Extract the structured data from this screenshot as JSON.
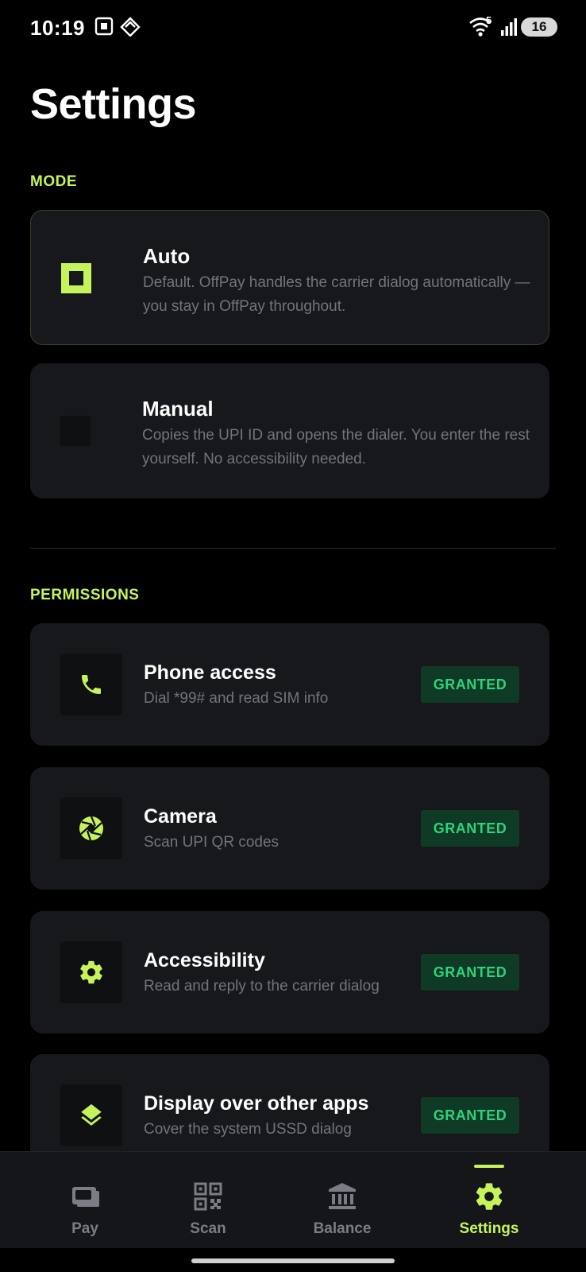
{
  "status_bar": {
    "time": "10:19",
    "battery": "16",
    "network_label": "5"
  },
  "page": {
    "title": "Settings"
  },
  "mode": {
    "section_label": "MODE",
    "options": [
      {
        "title": "Auto",
        "description": "Default. OffPay handles the carrier dialog automatically — you stay in OffPay throughout.",
        "selected": true
      },
      {
        "title": "Manual",
        "description": "Copies the UPI ID and opens the dialer. You enter the rest yourself. No accessibility needed.",
        "selected": false
      }
    ]
  },
  "permissions": {
    "section_label": "PERMISSIONS",
    "items": [
      {
        "title": "Phone access",
        "description": "Dial *99# and read SIM info",
        "status": "GRANTED",
        "icon": "phone-icon"
      },
      {
        "title": "Camera",
        "description": "Scan UPI QR codes",
        "status": "GRANTED",
        "icon": "camera-aperture-icon"
      },
      {
        "title": "Accessibility",
        "description": "Read and reply to the carrier dialog",
        "status": "GRANTED",
        "icon": "gear-icon"
      },
      {
        "title": "Display over other apps",
        "description": "Cover the system USSD dialog",
        "status": "GRANTED",
        "icon": "layers-icon"
      }
    ]
  },
  "bottom_nav": {
    "items": [
      {
        "label": "Pay",
        "icon": "wallet-icon",
        "active": false
      },
      {
        "label": "Scan",
        "icon": "qr-code-icon",
        "active": false
      },
      {
        "label": "Balance",
        "icon": "bank-icon",
        "active": false
      },
      {
        "label": "Settings",
        "icon": "gear-icon",
        "active": true
      }
    ]
  },
  "colors": {
    "accent": "#c6f35c",
    "background": "#000000",
    "card": "#17181b",
    "granted_text": "#2fd27a",
    "granted_bg": "#0f3a25",
    "muted_text": "#70747c"
  }
}
